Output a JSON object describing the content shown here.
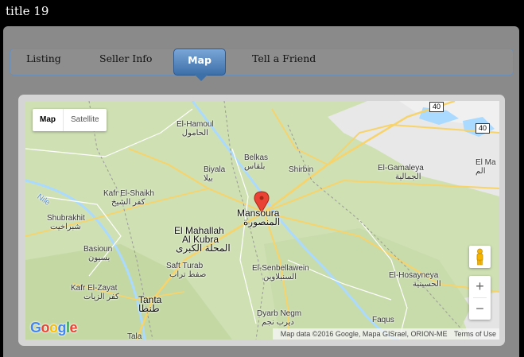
{
  "page": {
    "title": "title 19"
  },
  "tabs": [
    {
      "label": "Listing"
    },
    {
      "label": "Seller Info"
    },
    {
      "label": "Map"
    },
    {
      "label": "Tell a Friend"
    }
  ],
  "active_tab": "Map",
  "map": {
    "type_controls": {
      "map": "Map",
      "satellite": "Satellite"
    },
    "attribution": {
      "data": "Map data ©2016 Google, Mapa GISrael, ORION-ME",
      "terms": "Terms of Use"
    },
    "logo": "Google",
    "zoom_in": "+",
    "zoom_out": "−",
    "road_shields": [
      "40",
      "40"
    ],
    "places": {
      "el_hamoul": {
        "en": "El-Hamoul",
        "ar": "الحامول"
      },
      "belkas": {
        "en": "Belkas",
        "ar": "بلقاس"
      },
      "biyala": {
        "en": "Biyala",
        "ar": "بيلا"
      },
      "shirbin": {
        "en": "Shirbin"
      },
      "el_gamaleya": {
        "en": "El-Gamaleya",
        "ar": "الجمالية"
      },
      "el_ma": {
        "en": "El Ma",
        "ar": "الم"
      },
      "kafr_el_shaikh": {
        "en": "Kafr El-Shaikh",
        "ar": "كفر الشيخ"
      },
      "nile": {
        "en": "Nile"
      },
      "shubrakhit": {
        "en": "Shubrakhit",
        "ar": "شبراخيت"
      },
      "mansoura": {
        "en": "Mansoura",
        "ar": "المنصورة"
      },
      "el_mahallah": {
        "en": "El Mahallah",
        "en2": "Al Kubra",
        "ar": "المحلة الكبرى"
      },
      "basioun": {
        "en": "Basioun",
        "ar": "بسيون"
      },
      "saft_turab": {
        "en": "Saft Turab",
        "ar": "صفط تراب"
      },
      "el_senbellawein": {
        "en": "El-Senbellawein",
        "ar": "السنبلاوين"
      },
      "el_hosayneya": {
        "en": "El-Hosayneya",
        "ar": "الحسينية"
      },
      "kafr_el_zayat": {
        "en": "Kafr El-Zayat",
        "ar": "كفر الزيات"
      },
      "tanta": {
        "en": "Tanta",
        "ar": "طنطا"
      },
      "dyarb_negm": {
        "en": "Dyarb Negm",
        "ar": "ديرب نجم"
      },
      "faqus": {
        "en": "Faqus"
      },
      "tala": {
        "en": "Tala"
      }
    }
  }
}
